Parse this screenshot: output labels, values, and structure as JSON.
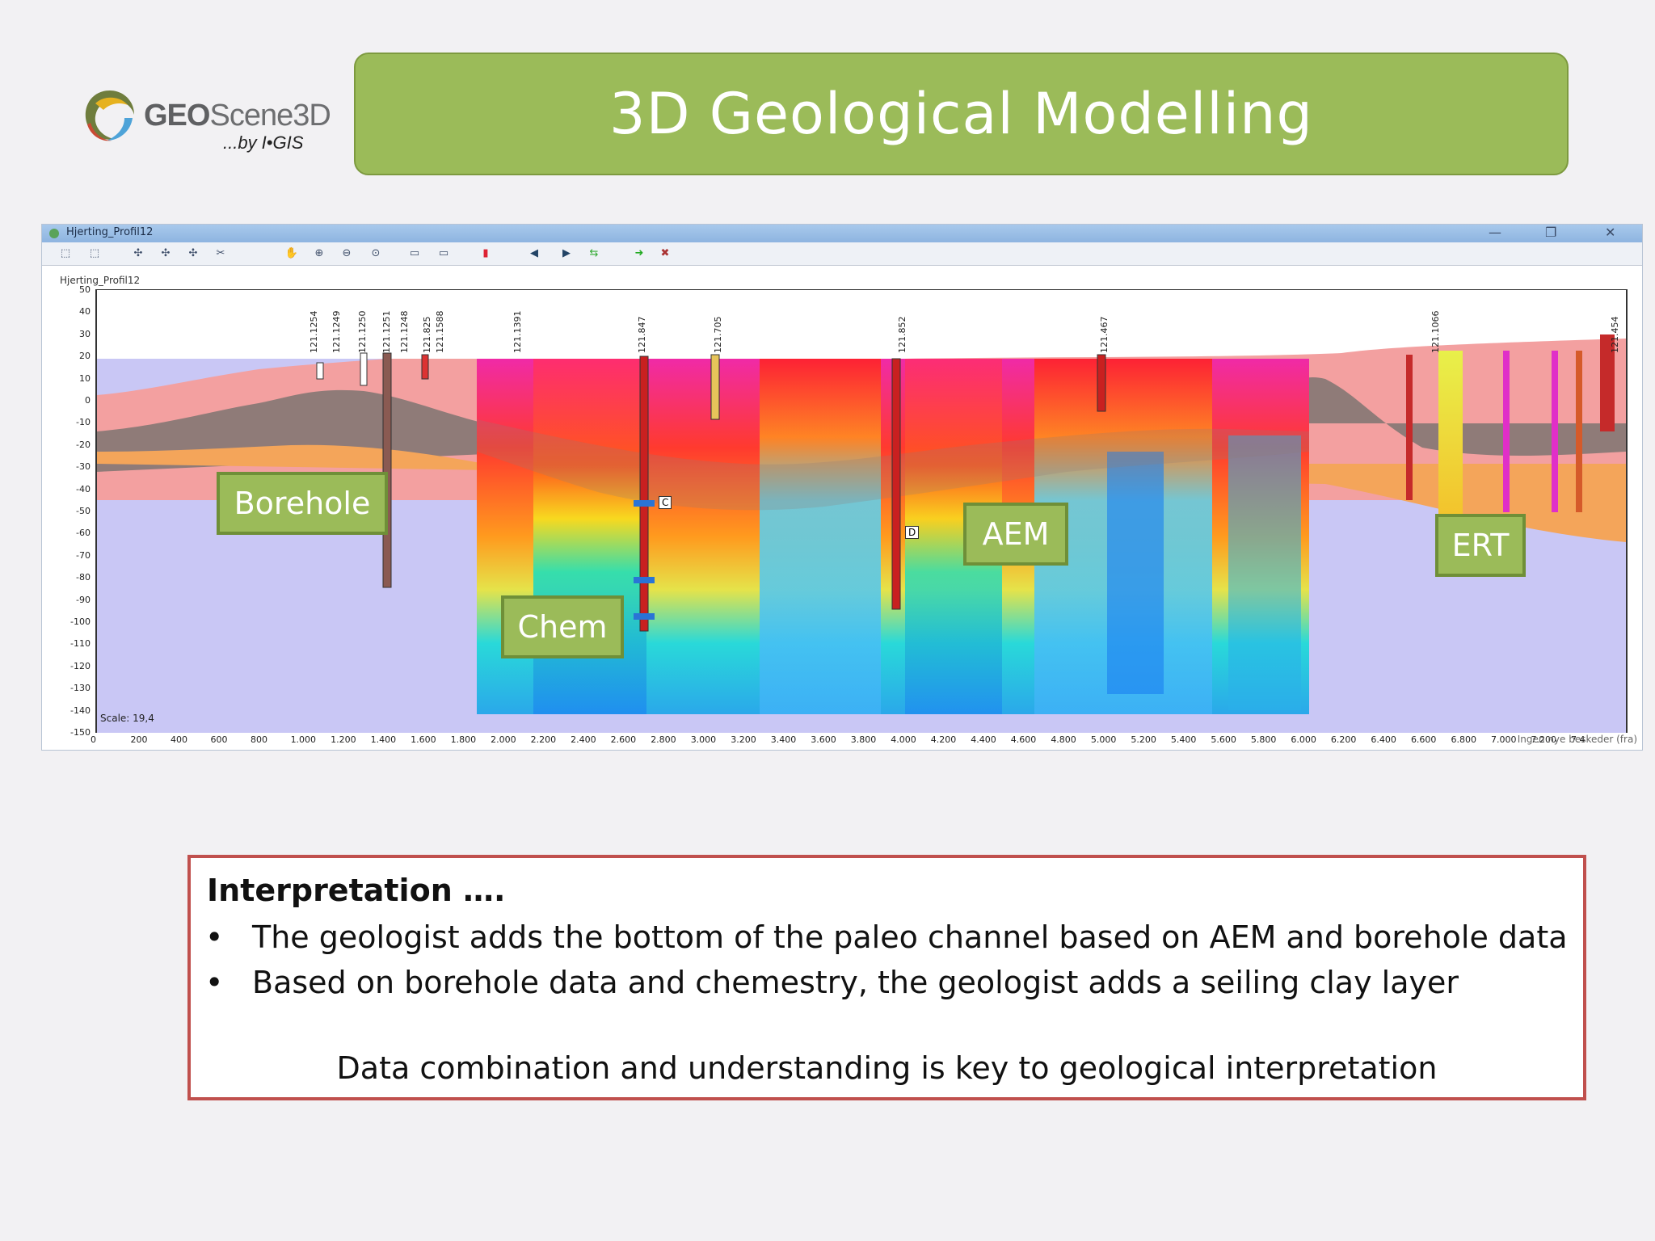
{
  "logo": {
    "brand_bold": "GEO",
    "brand_light": "Scene3D",
    "byline": "...by I•GIS"
  },
  "title": "3D Geological Modelling",
  "window": {
    "title": "Hjerting_Profil12",
    "profile_label": "Hjerting_Profil12",
    "scale_text": "Scale: 19,4",
    "status_text": "Ingen nye beskeder (fra)",
    "y_axis_ticks": [
      "50",
      "40",
      "30",
      "20",
      "10",
      "0",
      "-10",
      "-20",
      "-30",
      "-40",
      "-50",
      "-60",
      "-70",
      "-80",
      "-90",
      "-100",
      "-110",
      "-120",
      "-130",
      "-140",
      "-150"
    ],
    "x_axis_ticks": [
      "0",
      "200",
      "400",
      "600",
      "800",
      "1.000",
      "1.200",
      "1.400",
      "1.600",
      "1.800",
      "2.000",
      "2.200",
      "2.400",
      "2.600",
      "2.800",
      "3.000",
      "3.200",
      "3.400",
      "3.600",
      "3.800",
      "4.000",
      "4.200",
      "4.400",
      "4.600",
      "4.800",
      "5.000",
      "5.200",
      "5.400",
      "5.600",
      "5.800",
      "6.000",
      "6.200",
      "6.400",
      "6.600",
      "6.800",
      "7.000",
      "7.200",
      "7.4"
    ],
    "borehole_ids": [
      "121.1254",
      "121.1249",
      "121.1250",
      "121.1251",
      "121.1248",
      "121.825",
      "121.1588",
      "121.1391",
      "121.847",
      "121.705",
      "121.852",
      "121.467",
      "121.1066",
      "121.454"
    ],
    "markers": [
      "C",
      "D"
    ]
  },
  "labels": {
    "borehole": "Borehole",
    "chem": "Chem",
    "aem": "AEM",
    "ert": "ERT"
  },
  "notes": {
    "heading": "Interpretation ….",
    "bullets": [
      "The geologist adds the bottom of the paleo channel based on AEM and borehole data",
      "Based on borehole data and chemestry, the geologist adds a seiling clay layer"
    ],
    "conclusion": "Data combination and understanding is key to geological interpretation",
    "bullet_char": "•"
  },
  "colors": {
    "title_green": "#9bbb59",
    "notes_border": "#c0504d",
    "basement": "#c9c7f5",
    "top_layer": "#f3a0a0",
    "clay_layer": "#8f7b78",
    "sand_layer": "#f4a55a"
  }
}
